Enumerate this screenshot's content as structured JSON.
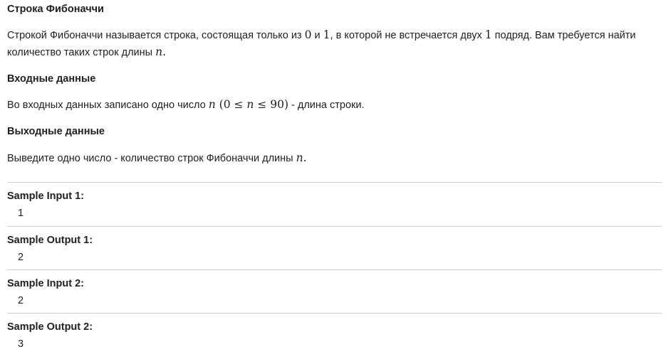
{
  "problem": {
    "title": "Строка Фибоначчи",
    "legend": {
      "part1": "Строкой Фибоначчи называется строка, состоящая только из ",
      "zero": "0",
      "part2": " и ",
      "one": "1",
      "part3": ", в которой не встречается двух ",
      "one2": "1",
      "part4": " подряд. Вам требуется найти количество таких строк длины ",
      "n": "n",
      "end": "."
    },
    "input": {
      "heading": "Входные данные",
      "part1": "Во входных данных записано одно число ",
      "n": "n",
      "constraint": "(0 ≤ ",
      "n2": "n",
      "constraint2": " ≤ 90)",
      "part2": " - длина строки."
    },
    "output": {
      "heading": "Выходные данные",
      "part1": "Выведите одно число - количество строк Фибоначчи длины ",
      "n": "n",
      "end": "."
    },
    "samples": [
      {
        "label": "Sample Input 1:",
        "value": "1"
      },
      {
        "label": "Sample Output 1:",
        "value": "2"
      },
      {
        "label": "Sample Input 2:",
        "value": "2"
      },
      {
        "label": "Sample Output 2:",
        "value": "3"
      }
    ]
  }
}
